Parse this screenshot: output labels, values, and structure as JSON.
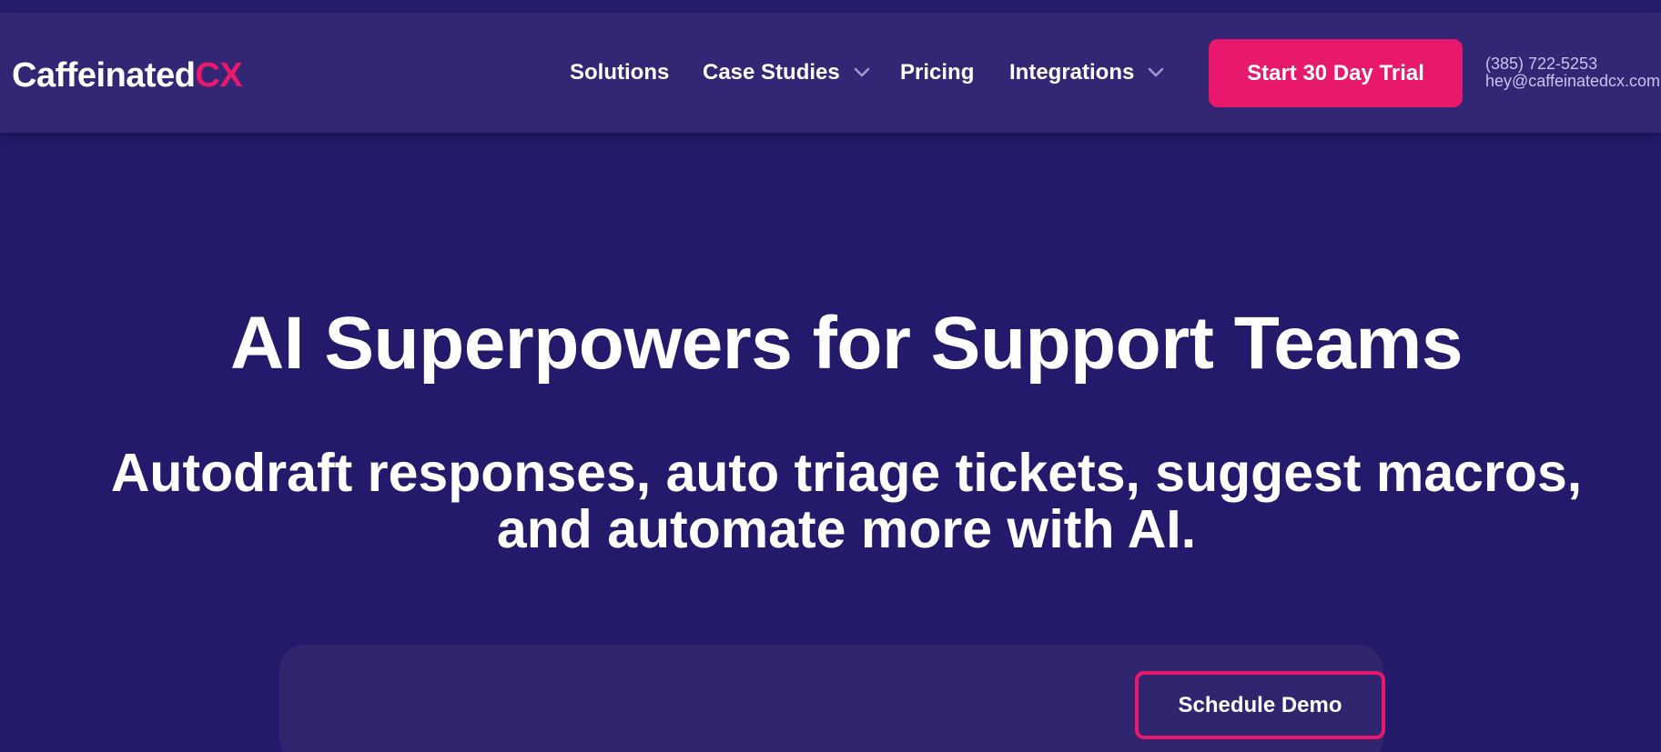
{
  "brand": {
    "logo_main": "Caffeinated",
    "logo_accent": "CX",
    "accent_color": "#e8186c",
    "background_color": "#231a6b",
    "navbar_color": "#332775"
  },
  "nav": {
    "items": [
      {
        "label": "Solutions",
        "has_dropdown": false
      },
      {
        "label": "Case Studies",
        "has_dropdown": true,
        "icon": "chevron-down-icon"
      },
      {
        "label": "Pricing",
        "has_dropdown": false
      },
      {
        "label": "Integrations",
        "has_dropdown": true,
        "icon": "chevron-down-icon"
      }
    ],
    "cta_label": "Start 30 Day Trial",
    "phone": "(385) 722-5253",
    "email": "hey@caffeinatedcx.com"
  },
  "hero": {
    "title": "AI Superpowers for Support Teams",
    "subtitle_line1": "Autodraft responses, auto triage tickets, suggest macros,",
    "subtitle_line2": "and automate more with AI."
  },
  "form": {
    "demo_button_label": "Schedule Demo"
  }
}
